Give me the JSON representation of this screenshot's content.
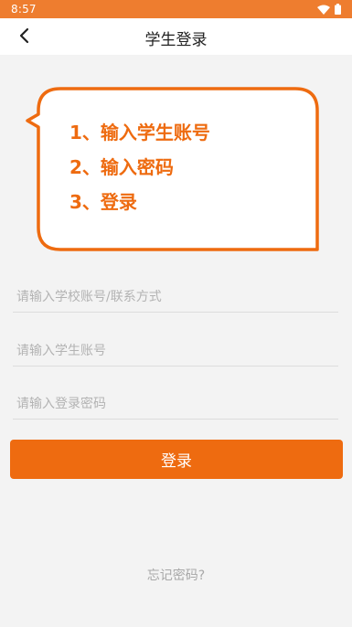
{
  "status_bar": {
    "time": "8:57",
    "wifi_icon": "wifi-icon",
    "battery_icon": "battery-icon"
  },
  "header": {
    "title": "学生登录",
    "back_icon": "chevron-left-icon"
  },
  "instructions": {
    "steps": [
      "1、输入学生账号",
      "2、输入密码",
      "3、登录"
    ],
    "accent_color": "#ee6b10"
  },
  "form": {
    "school_account_placeholder": "请输入学校账号/联系方式",
    "student_account_placeholder": "请输入学生账号",
    "password_placeholder": "请输入登录密码",
    "login_label": "登录"
  },
  "forgot_password_label": "忘记密码?",
  "colors": {
    "status_bar": "#ee7d2f",
    "primary": "#ee6b10",
    "background": "#f3f3f3"
  }
}
